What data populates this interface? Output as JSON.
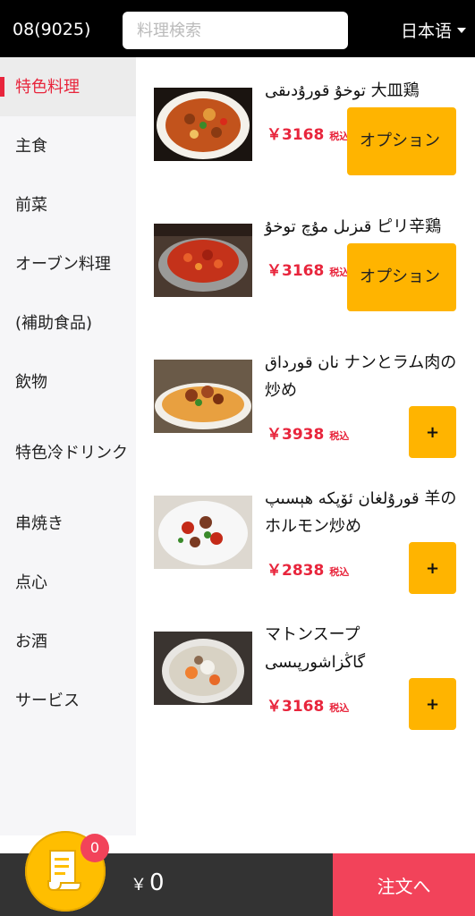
{
  "header": {
    "table_number": "08(9025)",
    "search_placeholder": "料理検索",
    "language": "日本语"
  },
  "sidebar": {
    "items": [
      {
        "label": "特色料理",
        "active": true
      },
      {
        "label": "主食"
      },
      {
        "label": "前菜"
      },
      {
        "label": "オーブン料理"
      },
      {
        "label": "(補助食品)"
      },
      {
        "label": "飲物"
      },
      {
        "label": "特色冷ドリンク"
      },
      {
        "label": "串焼き"
      },
      {
        "label": "点心"
      },
      {
        "label": "お酒"
      },
      {
        "label": "サービス"
      }
    ]
  },
  "menu": {
    "items": [
      {
        "name": "توخۇ قورۇدىقى 大皿鶏",
        "price": "3168",
        "tax": "税込",
        "button": "オプション",
        "button_type": "option"
      },
      {
        "name": "قىزىل مۇچ توخۇ ピリ辛鶏",
        "price": "3168",
        "tax": "税込",
        "button": "オプション",
        "button_type": "option"
      },
      {
        "name": "نان قورداق ナンとラム肉の炒め",
        "price": "3938",
        "tax": "税込",
        "button": "+",
        "button_type": "add"
      },
      {
        "name": "قورۇلغان ئۆپكە ھېسىپ 羊のホルモン炒め",
        "price": "2838",
        "tax": "税込",
        "button": "+",
        "button_type": "add"
      },
      {
        "name": "マトンスープ گاڭزاشورپىسى",
        "price": "3168",
        "tax": "税込",
        "button": "+",
        "button_type": "add"
      }
    ],
    "currency": "￥"
  },
  "cart": {
    "count": "0",
    "currency": "￥",
    "total": "0",
    "order_label": "注文へ"
  },
  "colors": {
    "accent": "#e8253c",
    "button": "#ffb400",
    "header": "#000000",
    "bottom_bar": "#333333",
    "order_button": "#f2435a"
  }
}
